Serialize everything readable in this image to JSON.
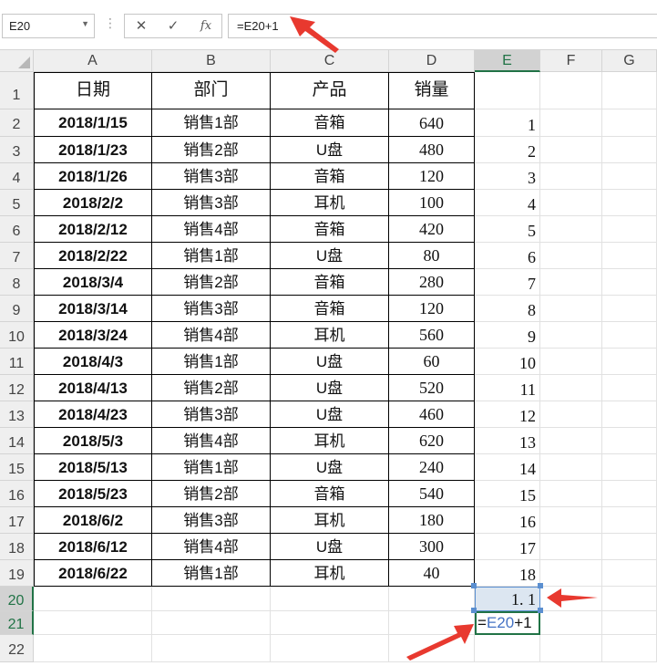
{
  "formula_bar": {
    "name_box": "E20",
    "cancel_icon": "✕",
    "confirm_icon": "✓",
    "fx_label": "fx",
    "formula": "=E20+1"
  },
  "columns": [
    "A",
    "B",
    "C",
    "D",
    "E",
    "F",
    "G"
  ],
  "rows": [
    "1",
    "2",
    "3",
    "4",
    "5",
    "6",
    "7",
    "8",
    "9",
    "10",
    "11",
    "12",
    "13",
    "14",
    "15",
    "16",
    "17",
    "18",
    "19",
    "20",
    "21",
    "22"
  ],
  "headers": {
    "a": "日期",
    "b": "部门",
    "c": "产品",
    "d": "销量"
  },
  "data": [
    {
      "a": "2018/1/15",
      "b": "销售1部",
      "c": "音箱",
      "d": "640",
      "e": "1"
    },
    {
      "a": "2018/1/23",
      "b": "销售2部",
      "c": "U盘",
      "d": "480",
      "e": "2"
    },
    {
      "a": "2018/1/26",
      "b": "销售3部",
      "c": "音箱",
      "d": "120",
      "e": "3"
    },
    {
      "a": "2018/2/2",
      "b": "销售3部",
      "c": "耳机",
      "d": "100",
      "e": "4"
    },
    {
      "a": "2018/2/12",
      "b": "销售4部",
      "c": "音箱",
      "d": "420",
      "e": "5"
    },
    {
      "a": "2018/2/22",
      "b": "销售1部",
      "c": "U盘",
      "d": "80",
      "e": "6"
    },
    {
      "a": "2018/3/4",
      "b": "销售2部",
      "c": "音箱",
      "d": "280",
      "e": "7"
    },
    {
      "a": "2018/3/14",
      "b": "销售3部",
      "c": "音箱",
      "d": "120",
      "e": "8"
    },
    {
      "a": "2018/3/24",
      "b": "销售4部",
      "c": "耳机",
      "d": "560",
      "e": "9"
    },
    {
      "a": "2018/4/3",
      "b": "销售1部",
      "c": "U盘",
      "d": "60",
      "e": "10"
    },
    {
      "a": "2018/4/13",
      "b": "销售2部",
      "c": "U盘",
      "d": "520",
      "e": "11"
    },
    {
      "a": "2018/4/23",
      "b": "销售3部",
      "c": "U盘",
      "d": "460",
      "e": "12"
    },
    {
      "a": "2018/5/3",
      "b": "销售4部",
      "c": "耳机",
      "d": "620",
      "e": "13"
    },
    {
      "a": "2018/5/13",
      "b": "销售1部",
      "c": "U盘",
      "d": "240",
      "e": "14"
    },
    {
      "a": "2018/5/23",
      "b": "销售2部",
      "c": "音箱",
      "d": "540",
      "e": "15"
    },
    {
      "a": "2018/6/2",
      "b": "销售3部",
      "c": "耳机",
      "d": "180",
      "e": "16"
    },
    {
      "a": "2018/6/12",
      "b": "销售4部",
      "c": "U盘",
      "d": "300",
      "e": "17"
    },
    {
      "a": "2018/6/22",
      "b": "销售1部",
      "c": "耳机",
      "d": "40",
      "e": "18"
    }
  ],
  "e20_value": "1. 1",
  "e21_formula": {
    "prefix": "=",
    "ref": "E20",
    "suffix": "+1"
  },
  "colors": {
    "accent_green": "#217346",
    "annotation_red": "#e8392f",
    "selection_blue": "#dce6f1"
  }
}
